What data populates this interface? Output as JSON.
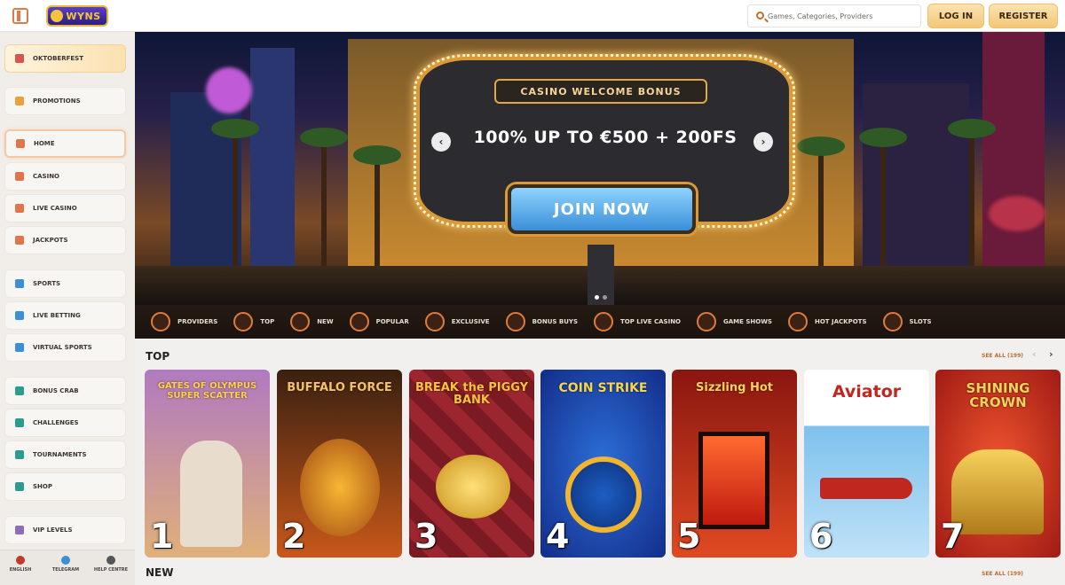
{
  "header": {
    "logo_text": "WYNS",
    "search_placeholder": "Games, Categories, Providers",
    "login_label": "LOG IN",
    "register_label": "REGISTER"
  },
  "sidebar": {
    "items": [
      {
        "label": "OKTOBERFEST",
        "icon": "beer-mug-icon",
        "color": "#d9534f"
      },
      {
        "label": "PROMOTIONS",
        "icon": "gift-icon",
        "color": "#e9a23b"
      },
      {
        "label": "HOME",
        "icon": "home-icon",
        "color": "#e0744a"
      },
      {
        "label": "CASINO",
        "icon": "slot-machine-icon",
        "color": "#e0744a"
      },
      {
        "label": "LIVE CASINO",
        "icon": "dealer-icon",
        "color": "#e0744a"
      },
      {
        "label": "JACKPOTS",
        "icon": "jackpot-icon",
        "color": "#e0744a"
      },
      {
        "label": "SPORTS",
        "icon": "ball-icon",
        "color": "#3a8fd8"
      },
      {
        "label": "LIVE BETTING",
        "icon": "live-screen-icon",
        "color": "#3a8fd8"
      },
      {
        "label": "VIRTUAL SPORTS",
        "icon": "monitor-icon",
        "color": "#3a8fd8"
      },
      {
        "label": "BONUS CRAB",
        "icon": "crab-icon",
        "color": "#2a9d8f"
      },
      {
        "label": "CHALLENGES",
        "icon": "medal-icon",
        "color": "#2a9d8f"
      },
      {
        "label": "TOURNAMENTS",
        "icon": "trophy-icon",
        "color": "#2a9d8f"
      },
      {
        "label": "SHOP",
        "icon": "shop-icon",
        "color": "#2a9d8f"
      },
      {
        "label": "VIP LEVELS",
        "icon": "diamond-icon",
        "color": "#8e6bbf"
      }
    ],
    "footer": [
      {
        "label": "ENGLISH",
        "icon": "flag-uk-icon",
        "color": "#c0392b"
      },
      {
        "label": "TELEGRAM",
        "icon": "telegram-icon",
        "color": "#3a8fd8"
      },
      {
        "label": "HELP CENTRE",
        "icon": "help-icon",
        "color": "#555555"
      }
    ]
  },
  "hero": {
    "tag": "CASINO WELCOME BONUS",
    "headline": "100% UP TO €500 + 200FS",
    "cta": "JOIN NOW",
    "prev": "‹",
    "next": "›",
    "slide_count": 2,
    "active_slide": 1
  },
  "categories": [
    {
      "label": "PROVIDERS",
      "icon": "providers-icon"
    },
    {
      "label": "TOP",
      "icon": "crown-icon"
    },
    {
      "label": "NEW",
      "icon": "lightning-icon"
    },
    {
      "label": "POPULAR",
      "icon": "fire-icon"
    },
    {
      "label": "EXCLUSIVE",
      "icon": "diamond-icon"
    },
    {
      "label": "BONUS BUYS",
      "icon": "gift-icon"
    },
    {
      "label": "TOP LIVE CASINO",
      "icon": "star-icon"
    },
    {
      "label": "GAME SHOWS",
      "icon": "microphone-icon"
    },
    {
      "label": "HOT JACKPOTS",
      "icon": "hot-icon"
    },
    {
      "label": "SLOTS",
      "icon": "slots-icon"
    }
  ],
  "top_section": {
    "title": "TOP",
    "see_all": "SEE ALL (199)",
    "prev": "‹",
    "next": "›",
    "games": [
      {
        "title": "GATES OF OLYMPUS SUPER SCATTER",
        "rank": "1",
        "bg": "#c79a6b",
        "fg": "#f6d35a"
      },
      {
        "title": "BUFFALO FORCE",
        "rank": "2",
        "bg": "#6b3a1e",
        "fg": "#f4c26a"
      },
      {
        "title": "BREAK the PIGGY BANK",
        "rank": "3",
        "bg": "#7a1a22",
        "fg": "#f5c33b"
      },
      {
        "title": "COIN STRIKE",
        "rank": "4",
        "bg": "#1c3fa0",
        "fg": "#f6d64a"
      },
      {
        "title": "Sizzling Hot",
        "rank": "5",
        "bg": "#b0261c",
        "fg": "#ffd15c"
      },
      {
        "title": "Aviator",
        "rank": "6",
        "bg": "#7ec1ec",
        "fg": "#c0271e"
      },
      {
        "title": "SHINING CROWN",
        "rank": "7",
        "bg": "#c92a22",
        "fg": "#f7d25b"
      }
    ]
  },
  "new_section": {
    "title": "NEW",
    "see_all": "SEE ALL (199)"
  }
}
